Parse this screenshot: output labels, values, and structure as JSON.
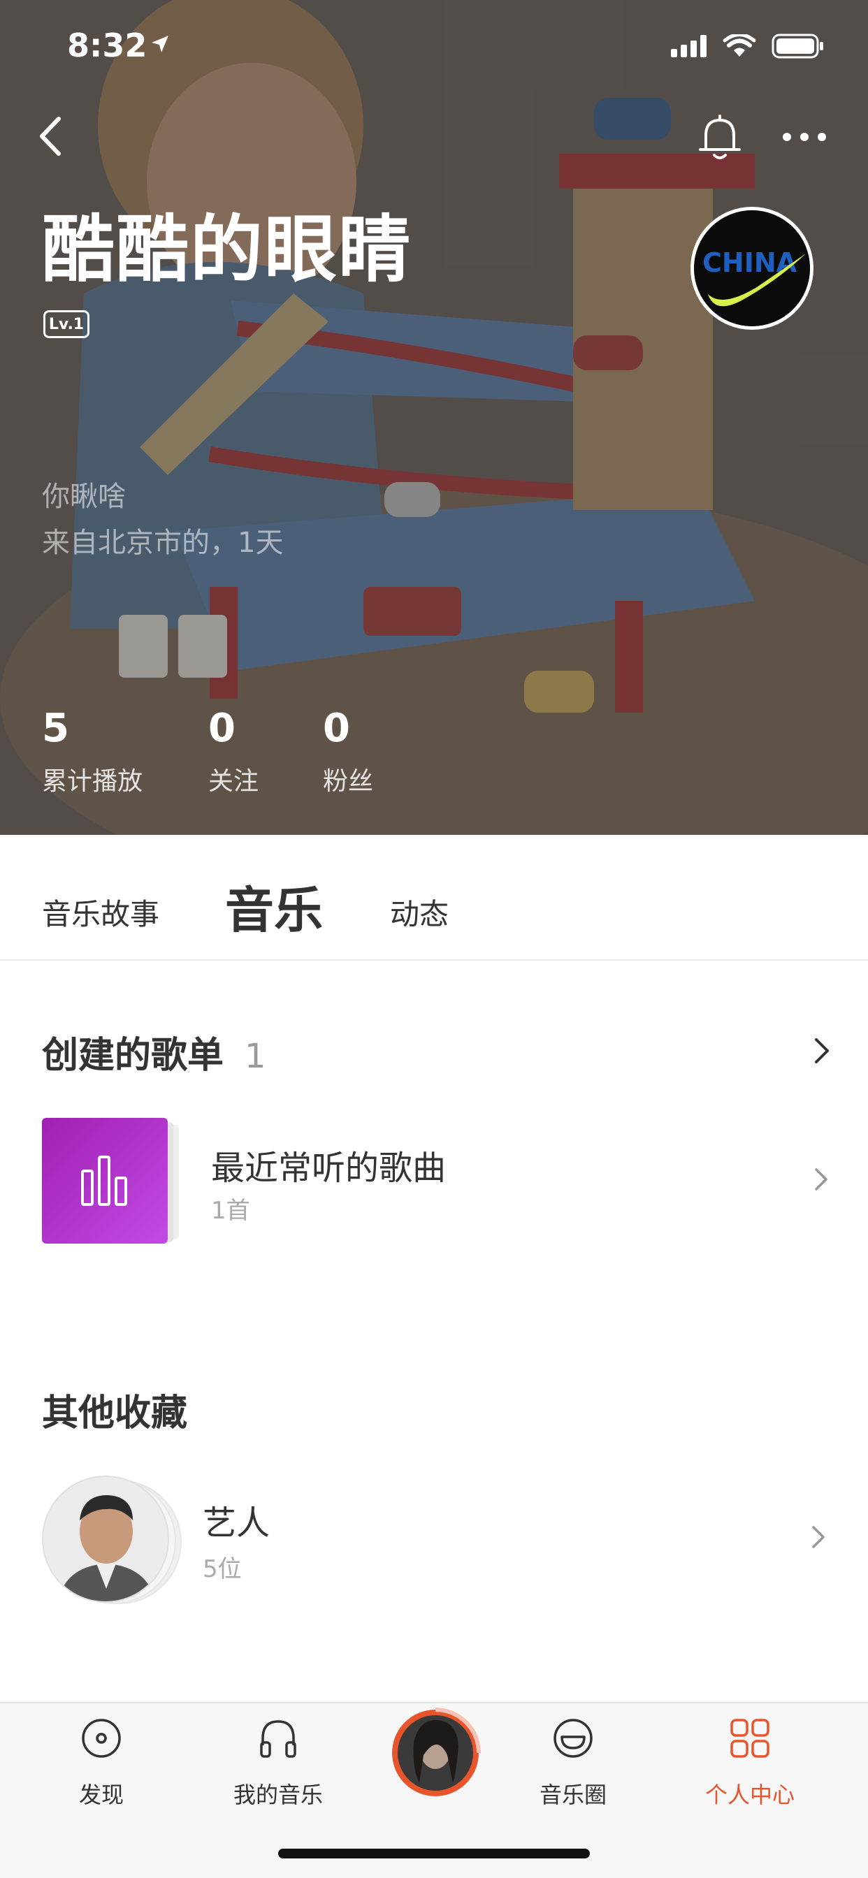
{
  "status": {
    "time": "8:32",
    "location_icon": "location-arrow-icon",
    "signal_icon": "cellular-signal-icon",
    "wifi_icon": "wifi-icon",
    "battery_icon": "battery-icon"
  },
  "header": {
    "back_icon": "chevron-left-icon",
    "bell_icon": "bell-icon",
    "more_icon": "more-dots-icon",
    "user_name": "酷酷的眼睛",
    "level": "Lv.1",
    "avatar_text": "CHINA",
    "signature": "你瞅啥",
    "location": "来自北京市的，1天",
    "stats": [
      {
        "value": "5",
        "label": "累计播放"
      },
      {
        "value": "0",
        "label": "关注"
      },
      {
        "value": "0",
        "label": "粉丝"
      }
    ]
  },
  "tabs": [
    {
      "label": "音乐故事",
      "active": false
    },
    {
      "label": "音乐",
      "active": true
    },
    {
      "label": "动态",
      "active": false
    }
  ],
  "created_playlists": {
    "title": "创建的歌单",
    "count": "1",
    "items": [
      {
        "title": "最近常听的歌曲",
        "subtitle": "1首",
        "cover_icon": "bar-chart-icon"
      }
    ]
  },
  "other_collections": {
    "title": "其他收藏",
    "items": [
      {
        "title": "艺人",
        "subtitle": "5位"
      }
    ]
  },
  "tabbar": {
    "items": [
      {
        "label": "发现",
        "icon": "disc-icon",
        "active": false
      },
      {
        "label": "我的音乐",
        "icon": "headphones-icon",
        "active": false
      },
      {
        "label": "",
        "icon": "now-playing-avatar",
        "active": false
      },
      {
        "label": "音乐圈",
        "icon": "smile-icon",
        "active": false
      },
      {
        "label": "个人中心",
        "icon": "grid-icon",
        "active": true
      }
    ],
    "accent": "#e8542c"
  },
  "colors": {
    "accent": "#e8542c",
    "playlist_cover": "#b535d6"
  }
}
